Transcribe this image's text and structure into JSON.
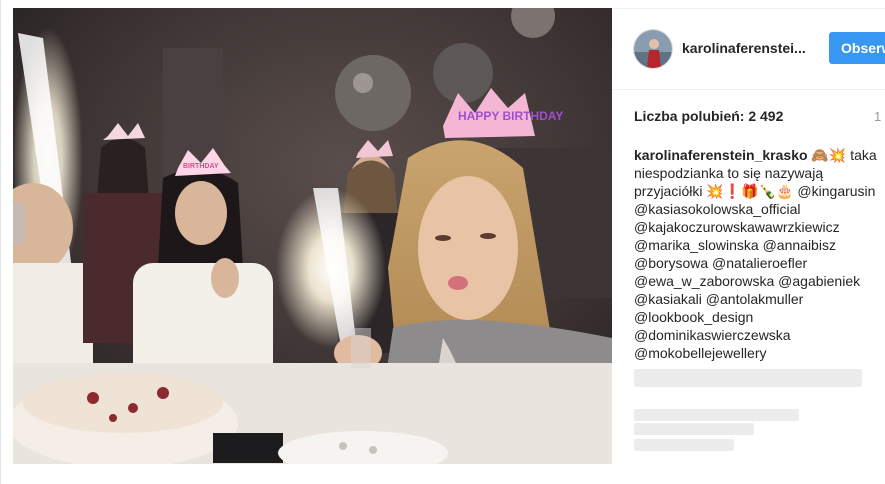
{
  "post": {
    "username": "karolinaferenstei...",
    "follow_label": "Obserwuj",
    "likes_label": "Liczba polubień: 2 492",
    "date_stub": "1",
    "caption_author": "karolinaferenstein_krasko",
    "caption_emoji_1": "🙈💥",
    "caption_text": "taka niespodzianka to się nazywają przyjaciółki",
    "caption_emoji_2": "💥❗🎁🍾🎂",
    "mentions_inline": "@kingarusin",
    "mentions": [
      "@kasiasokolowska_official",
      "@kajakoczurowskawawrzkiewicz",
      "@marika_slowinska @annaibisz",
      "@borysowa @natalieroefler",
      "@ewa_w_zaborowska @agabieniek",
      "@kasiakali @antolakmuller",
      "@lookbook_design",
      "@dominikaswierczewska",
      "@mokobellejewellery"
    ]
  },
  "photo": {
    "banner_text": "HAPPY BIRTHDAY",
    "crown_text": "HAPPY BIRTHDAY"
  }
}
